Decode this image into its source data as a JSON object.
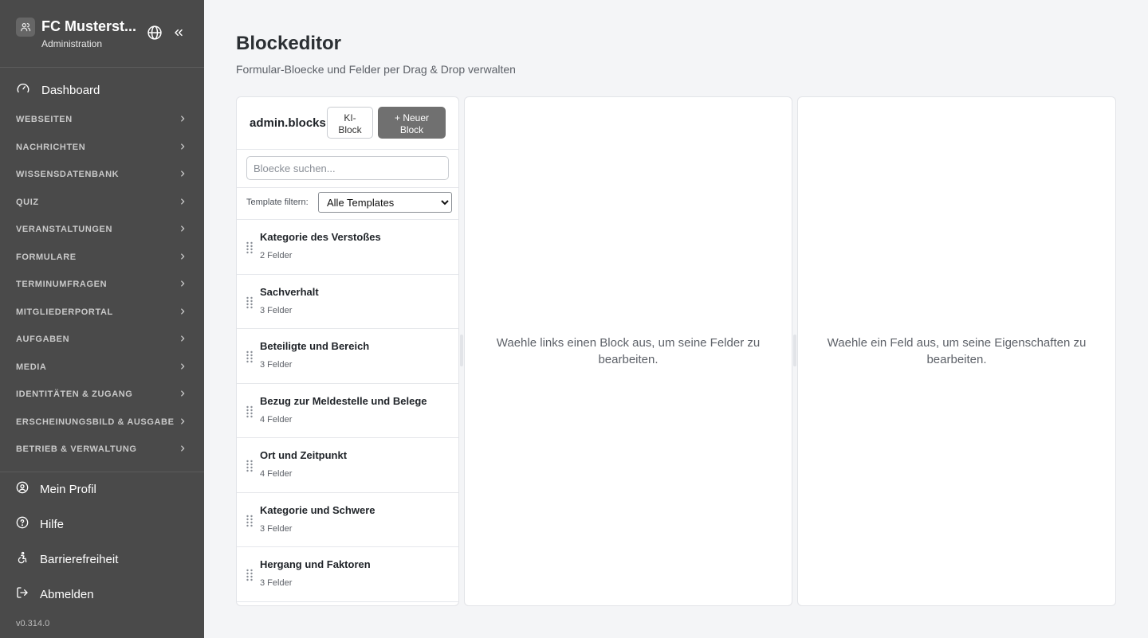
{
  "sidebar": {
    "org_name": "FC Musterst...",
    "org_sub": "Administration",
    "dashboard": "Dashboard",
    "sections": [
      {
        "label": "WEBSEITEN"
      },
      {
        "label": "NACHRICHTEN"
      },
      {
        "label": "WISSENSDATENBANK"
      },
      {
        "label": "QUIZ"
      },
      {
        "label": "VERANSTALTUNGEN"
      },
      {
        "label": "FORMULARE"
      },
      {
        "label": "TERMINUMFRAGEN"
      },
      {
        "label": "MITGLIEDERPORTAL"
      },
      {
        "label": "AUFGABEN"
      },
      {
        "label": "MEDIA"
      },
      {
        "label": "IDENTITÄTEN & ZUGANG"
      },
      {
        "label": "ERSCHEINUNGSBILD & AUSGABE"
      },
      {
        "label": "BETRIEB & VERWALTUNG"
      }
    ],
    "profile": "Mein Profil",
    "help": "Hilfe",
    "accessibility": "Barrierefreiheit",
    "logout": "Abmelden",
    "version": "v0.314.0"
  },
  "main": {
    "title": "Blockeditor",
    "subtitle": "Formular-Bloecke und Felder per Drag & Drop verwalten"
  },
  "blocks_panel": {
    "title": "admin.blocks",
    "ki_button": [
      "KI-",
      "Block"
    ],
    "new_button": [
      "+ Neuer",
      "Block"
    ],
    "search_placeholder": "Bloecke suchen...",
    "filter_label": "Template filtern:",
    "filter_selected": "Alle Templates",
    "items": [
      {
        "title": "Kategorie des Verstoßes",
        "count": "2 Felder"
      },
      {
        "title": "Sachverhalt",
        "count": "3 Felder"
      },
      {
        "title": "Beteiligte und Bereich",
        "count": "3 Felder"
      },
      {
        "title": "Bezug zur Meldestelle und Belege",
        "count": "4 Felder"
      },
      {
        "title": "Ort und Zeitpunkt",
        "count": "4 Felder"
      },
      {
        "title": "Kategorie und Schwere",
        "count": "3 Felder"
      },
      {
        "title": "Hergang und Faktoren",
        "count": "3 Felder"
      }
    ]
  },
  "fields_panel": {
    "empty": "Waehle links einen Block aus, um seine Felder zu bearbeiten."
  },
  "properties_panel": {
    "empty": "Waehle ein Feld aus, um seine Eigenschaften zu bearbeiten."
  },
  "icons": {
    "org": "users-icon",
    "globe": "globe-icon",
    "collapse": "chevrons-left-icon",
    "dashboard": "gauge-icon",
    "chevron": "chevron-right-icon",
    "profile": "user-circle-icon",
    "help": "help-circle-icon",
    "accessibility": "accessibility-icon",
    "logout": "log-out-icon",
    "drag": "grip-vertical-icon"
  }
}
